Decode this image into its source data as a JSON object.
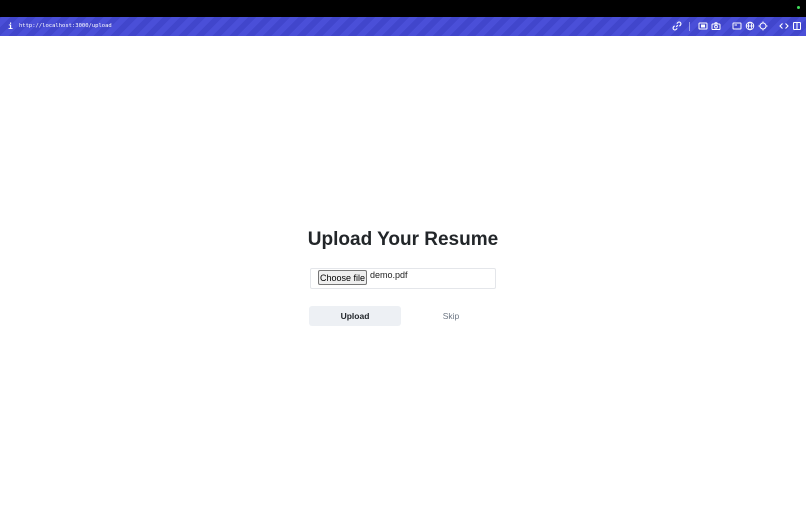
{
  "browser": {
    "url": "http://localhost:3000/upload",
    "info_icon": "info-icon",
    "toolbar_icons": [
      "link-icon",
      "screenshot-region-icon",
      "camera-icon",
      "panel-icon",
      "globe-icon",
      "crosshair-icon",
      "code-icon",
      "sidebar-icon"
    ]
  },
  "page": {
    "title": "Upload Your Resume",
    "file_input": {
      "button_label": "Choose file",
      "selected_file": "demo.pdf"
    },
    "upload_label": "Upload",
    "skip_label": "Skip"
  },
  "colors": {
    "url_bar": "#4a4fd8",
    "upload_button_bg": "#edf0f4",
    "skip_text": "#6e7784",
    "title_text": "#222629"
  }
}
